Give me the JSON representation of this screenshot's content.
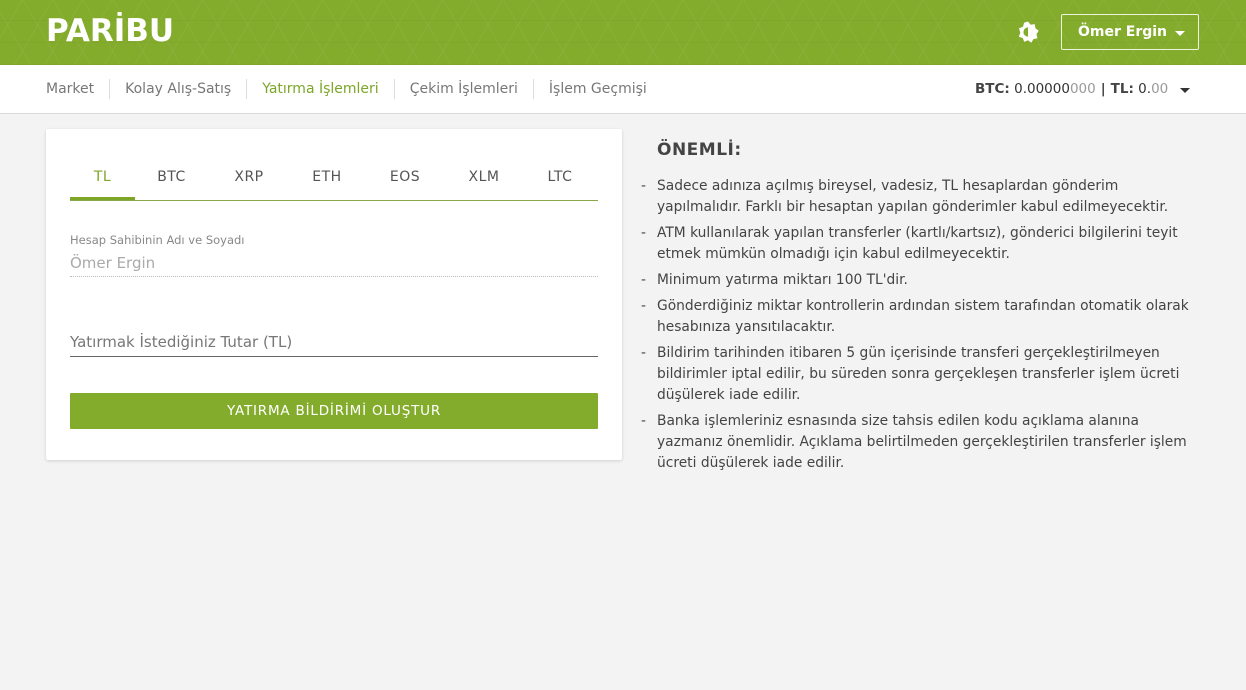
{
  "header": {
    "logo_text": "PARİBU",
    "theme_icon": "brightness-icon",
    "user_name": "Ömer Ergin"
  },
  "nav": {
    "links": [
      "Market",
      "Kolay Alış-Satış",
      "Yatırma İşlemleri",
      "Çekim İşlemleri",
      "İşlem Geçmişi"
    ],
    "active_index": 2
  },
  "balance": {
    "btc_label": "BTC:",
    "btc_main": "0.00000",
    "btc_dim": "000",
    "separator": "|",
    "tl_label": "TL:",
    "tl_main": "0.",
    "tl_dim": "00"
  },
  "deposit": {
    "tabs": [
      "TL",
      "BTC",
      "XRP",
      "ETH",
      "EOS",
      "XLM",
      "LTC"
    ],
    "active_tab": 0,
    "holder_label": "Hesap Sahibinin Adı ve Soyadı",
    "holder_value": "Ömer Ergin",
    "amount_placeholder": "Yatırmak İstediğiniz Tutar (TL)",
    "submit_label": "YATIRMA BİLDİRİMİ OLUŞTUR"
  },
  "notes": {
    "title": "ÖNEMLİ:",
    "dash": "-",
    "items": [
      "Sadece adınıza açılmış bireysel, vadesiz, TL hesaplardan gönderim yapılmalıdır. Farklı bir hesaptan yapılan gönderimler kabul edilmeyecektir.",
      "ATM kullanılarak yapılan transferler (kartlı/kartsız), gönderici bilgilerini teyit etmek mümkün olmadığı için kabul edilmeyecektir.",
      "Minimum yatırma miktarı 100 TL'dir.",
      "Gönderdiğiniz miktar kontrollerin ardından sistem tarafından otomatik olarak hesabınıza yansıtılacaktır.",
      "Bildirim tarihinden itibaren 5 gün içerisinde transferi gerçekleştirilmeyen bildirimler iptal edilir, bu süreden sonra gerçekleşen transferler işlem ücreti düşülerek iade edilir.",
      "Banka işlemleriniz esnasında size tahsis edilen kodu açıklama alanına yazmanız önemlidir. Açıklama belirtilmeden gerçekleştirilen transferler işlem ücreti düşülerek iade edilir."
    ]
  }
}
